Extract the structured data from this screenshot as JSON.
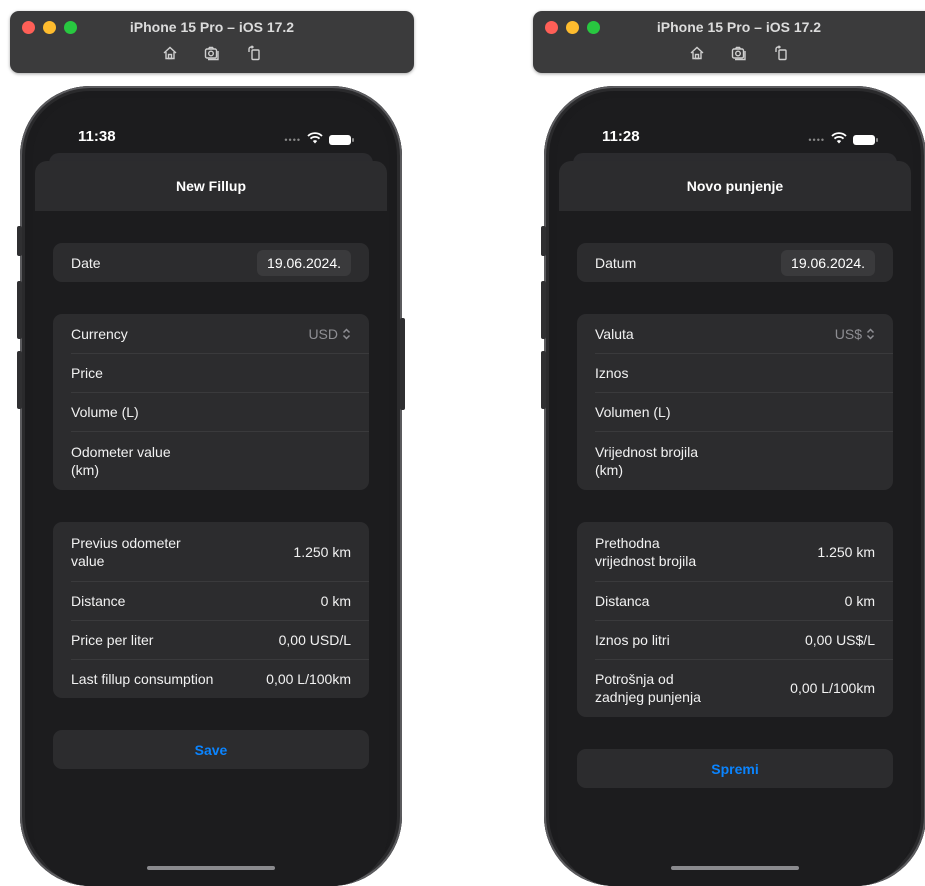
{
  "left": {
    "sim_title": "iPhone 15 Pro – iOS 17.2",
    "time": "11:38",
    "nav_title": "New Fillup",
    "date": {
      "label": "Date",
      "value": "19.06.2024."
    },
    "inputs": {
      "currency_label": "Currency",
      "currency_value": "USD",
      "price_label": "Price",
      "volume_label": "Volume (L)",
      "odometer_label_1": "Odometer value",
      "odometer_label_2": "(km)"
    },
    "stats": {
      "prev_label_1": "Previus odometer",
      "prev_label_2": "value",
      "prev_value": "1.250  km",
      "distance_label": "Distance",
      "distance_value": "0 km",
      "ppl_label": "Price per liter",
      "ppl_value": "0,00 USD/L",
      "cons_label": "Last fillup consumption",
      "cons_value": "0,00 L/100km"
    },
    "save_label": "Save"
  },
  "right": {
    "sim_title": "iPhone 15 Pro – iOS 17.2",
    "time": "11:28",
    "nav_title": "Novo punjenje",
    "date": {
      "label": "Datum",
      "value": "19.06.2024."
    },
    "inputs": {
      "currency_label": "Valuta",
      "currency_value": "US$",
      "price_label": "Iznos",
      "volume_label": "Volumen (L)",
      "odometer_label_1": "Vrijednost brojila",
      "odometer_label_2": "(km)"
    },
    "stats": {
      "prev_label_1": "Prethodna",
      "prev_label_2": "vrijednost brojila",
      "prev_value": "1.250  km",
      "distance_label": "Distanca",
      "distance_value": "0 km",
      "ppl_label": "Iznos po litri",
      "ppl_value": "0,00 US$/L",
      "cons_label_1": "Potrošnja od",
      "cons_label_2": "zadnjeg punjenja",
      "cons_value": "0,00 L/100km"
    },
    "save_label": "Spremi"
  },
  "colors": {
    "accent": "#0a84ff",
    "sheet_bg": "#1c1c1e",
    "group_bg": "#2c2c2e",
    "titlebar_bg": "#3b3b3c"
  },
  "icons": [
    "home-icon",
    "screenshot-icon",
    "rotate-icon",
    "wifi-icon",
    "battery-icon",
    "chevron-updown-icon"
  ]
}
